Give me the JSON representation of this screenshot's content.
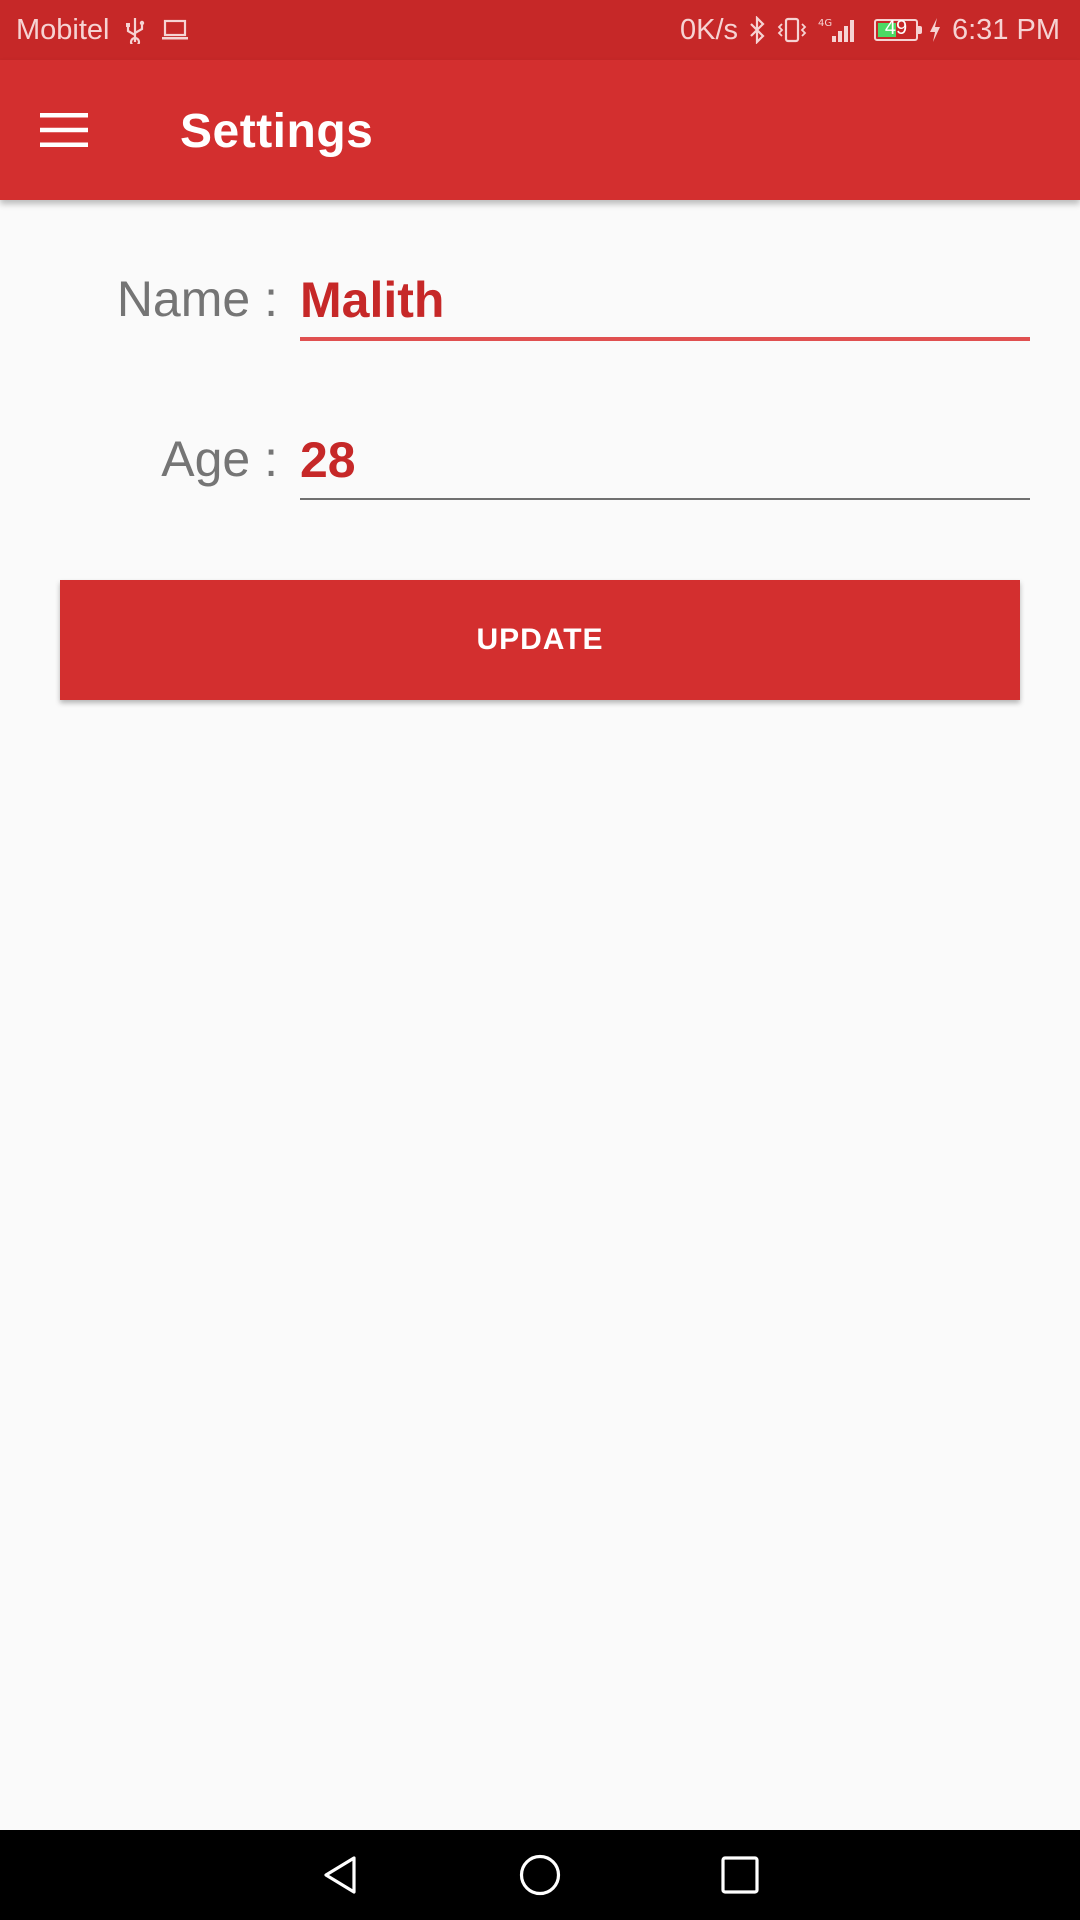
{
  "status_bar": {
    "carrier": "Mobitel",
    "net_speed": "0K/s",
    "network_type": "4G",
    "battery_level": "49",
    "battery_fraction": 0.49,
    "time": "6:31 PM",
    "icons": [
      "usb-icon",
      "laptop-icon",
      "bluetooth-icon",
      "vibrate-icon",
      "signal-icon",
      "battery-icon",
      "charging-icon"
    ]
  },
  "app_bar": {
    "title": "Settings",
    "menu_icon": "hamburger-menu-icon"
  },
  "form": {
    "name": {
      "label": "Name :",
      "value": "Malith"
    },
    "age": {
      "label": "Age :",
      "value": "28"
    }
  },
  "actions": {
    "update_label": "UPDATE"
  },
  "nav_bar": {
    "icons": [
      "back-icon",
      "home-icon",
      "recent-apps-icon"
    ]
  },
  "colors": {
    "primary": "#d32f2f",
    "primary_dark": "#c62828",
    "accent_text": "#c62828",
    "label_text": "#757575",
    "background": "#fafafa"
  }
}
